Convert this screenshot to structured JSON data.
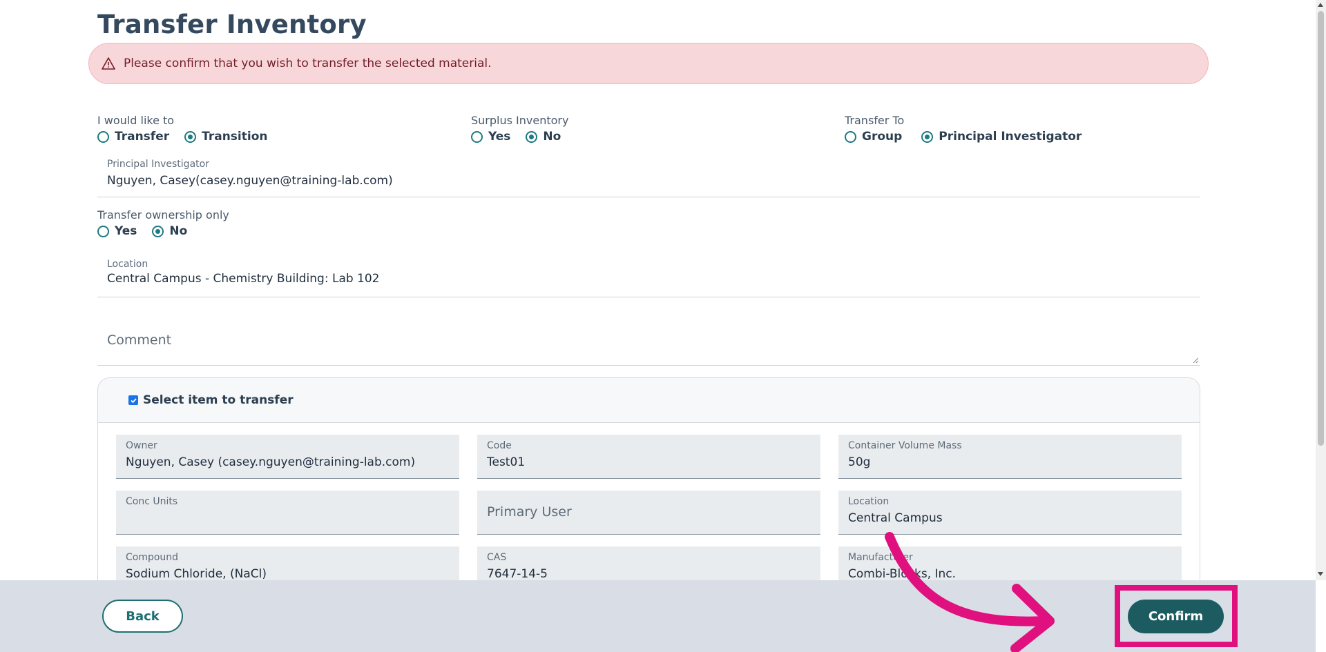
{
  "page": {
    "title": "Transfer Inventory"
  },
  "alert": {
    "message": "Please confirm that you wish to transfer the selected material."
  },
  "options": {
    "would_like_to": {
      "label": "I would like to",
      "choices": [
        "Transfer",
        "Transition"
      ],
      "selected": "Transition"
    },
    "surplus": {
      "label": "Surplus Inventory",
      "choices": [
        "Yes",
        "No"
      ],
      "selected": "No"
    },
    "transfer_to": {
      "label": "Transfer To",
      "choices": [
        "Group",
        "Principal Investigator"
      ],
      "selected": "Principal Investigator"
    },
    "ownership_only": {
      "label": "Transfer ownership only",
      "choices": [
        "Yes",
        "No"
      ],
      "selected": "No"
    }
  },
  "fields": {
    "pi": {
      "label": "Principal Investigator",
      "value": "Nguyen, Casey(casey.nguyen@training-lab.com)"
    },
    "location": {
      "label": "Location",
      "value": "Central Campus - Chemistry Building: Lab 102"
    },
    "comment": {
      "placeholder": "Comment"
    }
  },
  "item_card": {
    "header": "Select item to transfer",
    "checked": true,
    "tiles": [
      {
        "label": "Owner",
        "value": "Nguyen, Casey (casey.nguyen@training-lab.com)"
      },
      {
        "label": "Code",
        "value": "Test01"
      },
      {
        "label": "Container Volume Mass",
        "value": "50g"
      },
      {
        "label": "Conc Units",
        "value": ""
      },
      {
        "label": "",
        "value": "",
        "placeholder": "Primary User"
      },
      {
        "label": "Location",
        "value": "Central Campus"
      },
      {
        "label": "Compound",
        "value": "Sodium Chloride, (NaCl)"
      },
      {
        "label": "CAS",
        "value": "7647-14-5"
      },
      {
        "label": "Manufacturer",
        "value": "Combi-Blocks, Inc."
      }
    ]
  },
  "footer": {
    "back_label": "Back",
    "confirm_label": "Confirm"
  },
  "colors": {
    "accent": "#1c5c60",
    "highlight": "#e0117f",
    "alert_bg": "#f8d7da"
  }
}
